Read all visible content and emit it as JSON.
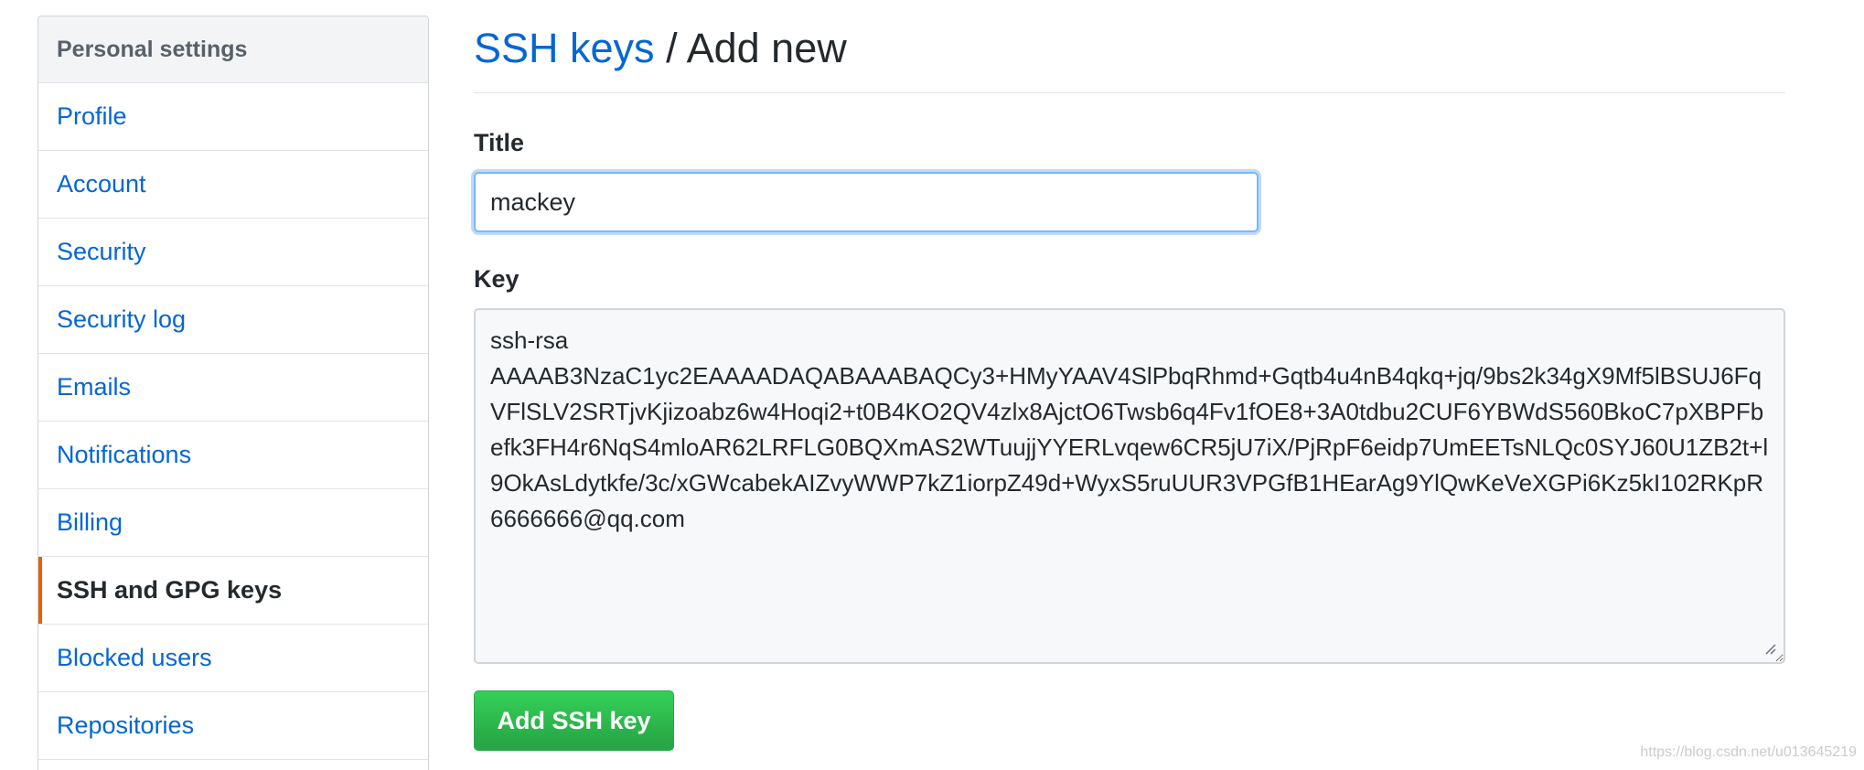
{
  "sidebar": {
    "header": "Personal settings",
    "items": [
      {
        "label": "Profile"
      },
      {
        "label": "Account"
      },
      {
        "label": "Security"
      },
      {
        "label": "Security log"
      },
      {
        "label": "Emails"
      },
      {
        "label": "Notifications"
      },
      {
        "label": "Billing"
      },
      {
        "label": "SSH and GPG keys"
      },
      {
        "label": "Blocked users"
      },
      {
        "label": "Repositories"
      }
    ],
    "selected": "SSH and GPG keys",
    "selected_accent_color": "#e36209"
  },
  "main": {
    "breadcrumb_link": "SSH keys",
    "breadcrumb_separator": " / ",
    "breadcrumb_current": "Add new",
    "title_label": "Title",
    "title_value": "mackey",
    "key_label": "Key",
    "key_value": "ssh-rsa\nAAAAB3NzaC1yc2EAAAADAQABAAABAQCy3+HMyYAAV4SlPbqRhmd+Gqtb4u4nB4qkq+jq/9bs2k34gX9Mf5lBSUJ6FqVFlSLV2SRTjvKjizoabz6w4Hoqi2+t0B4KO2QV4zlx8AjctO6Twsb6q4Fv1fOE8+3A0tdbu2CUF6YBWdS560BkoC7pXBPFbefk3FH4r6NqS4mloAR62LRFLG0BQXmAS2WTuujjYYERLvqew6CR5jU7iX/PjRpF6eidp7UmEETsNLQc0SYJ60U1ZB2t+l9OkAsLdytkfe/3c/xGWcabekAIZvyWWP7kZ1iorpZ49d+WyxS5ruUUR3VPGfB1HEarAg9YlQwKeVeXGPi6Kz5kI102RKpR 6666666@qq.com",
    "submit_label": "Add SSH key",
    "link_color": "#0366d6",
    "button_color": "#28a745"
  },
  "watermark": "https://blog.csdn.net/u013645219"
}
